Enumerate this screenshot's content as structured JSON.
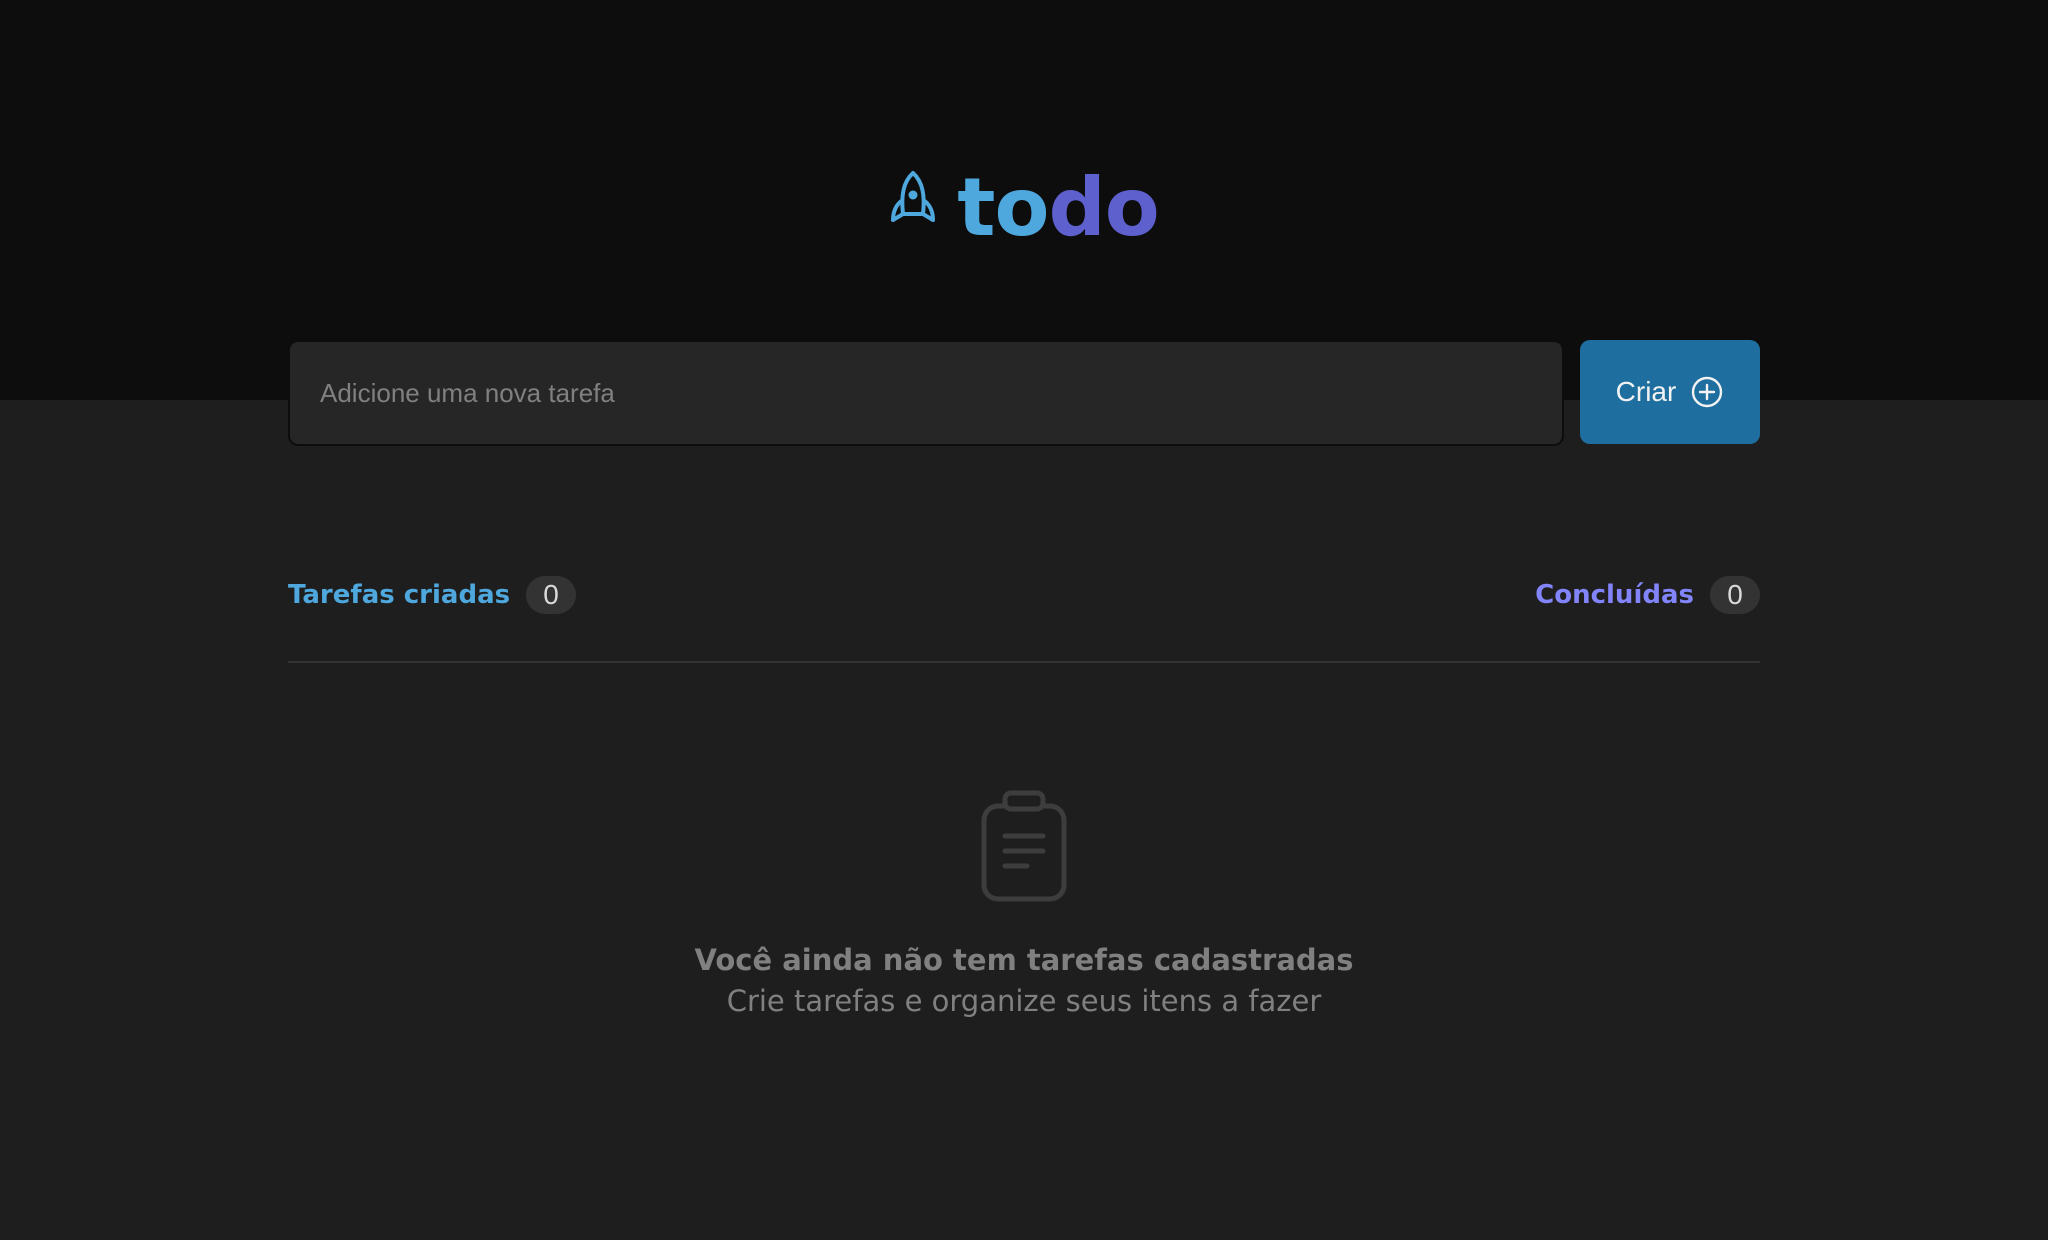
{
  "app": {
    "logo": {
      "icon": "rocket-icon",
      "text_part1": "to",
      "text_part2": "do"
    }
  },
  "new_task": {
    "placeholder": "Adicione uma nova tarefa",
    "value": "",
    "create_button_label": "Criar",
    "create_button_icon": "plus-circle-icon"
  },
  "counters": {
    "created_label": "Tarefas criadas",
    "created_count": "0",
    "done_label": "Concluídas",
    "done_count": "0"
  },
  "empty_state": {
    "icon": "clipboard-icon",
    "title": "Você ainda não tem tarefas cadastradas",
    "subtitle": "Crie tarefas e organize seus itens a fazer"
  },
  "colors": {
    "header_bg": "#0d0d0d",
    "body_bg": "#1e1e1e",
    "blue": "#4ea8de",
    "blue_dark": "#1e6f9f",
    "purple": "#5e60ce",
    "purple_light": "#8284fa",
    "gray": "#808080"
  }
}
